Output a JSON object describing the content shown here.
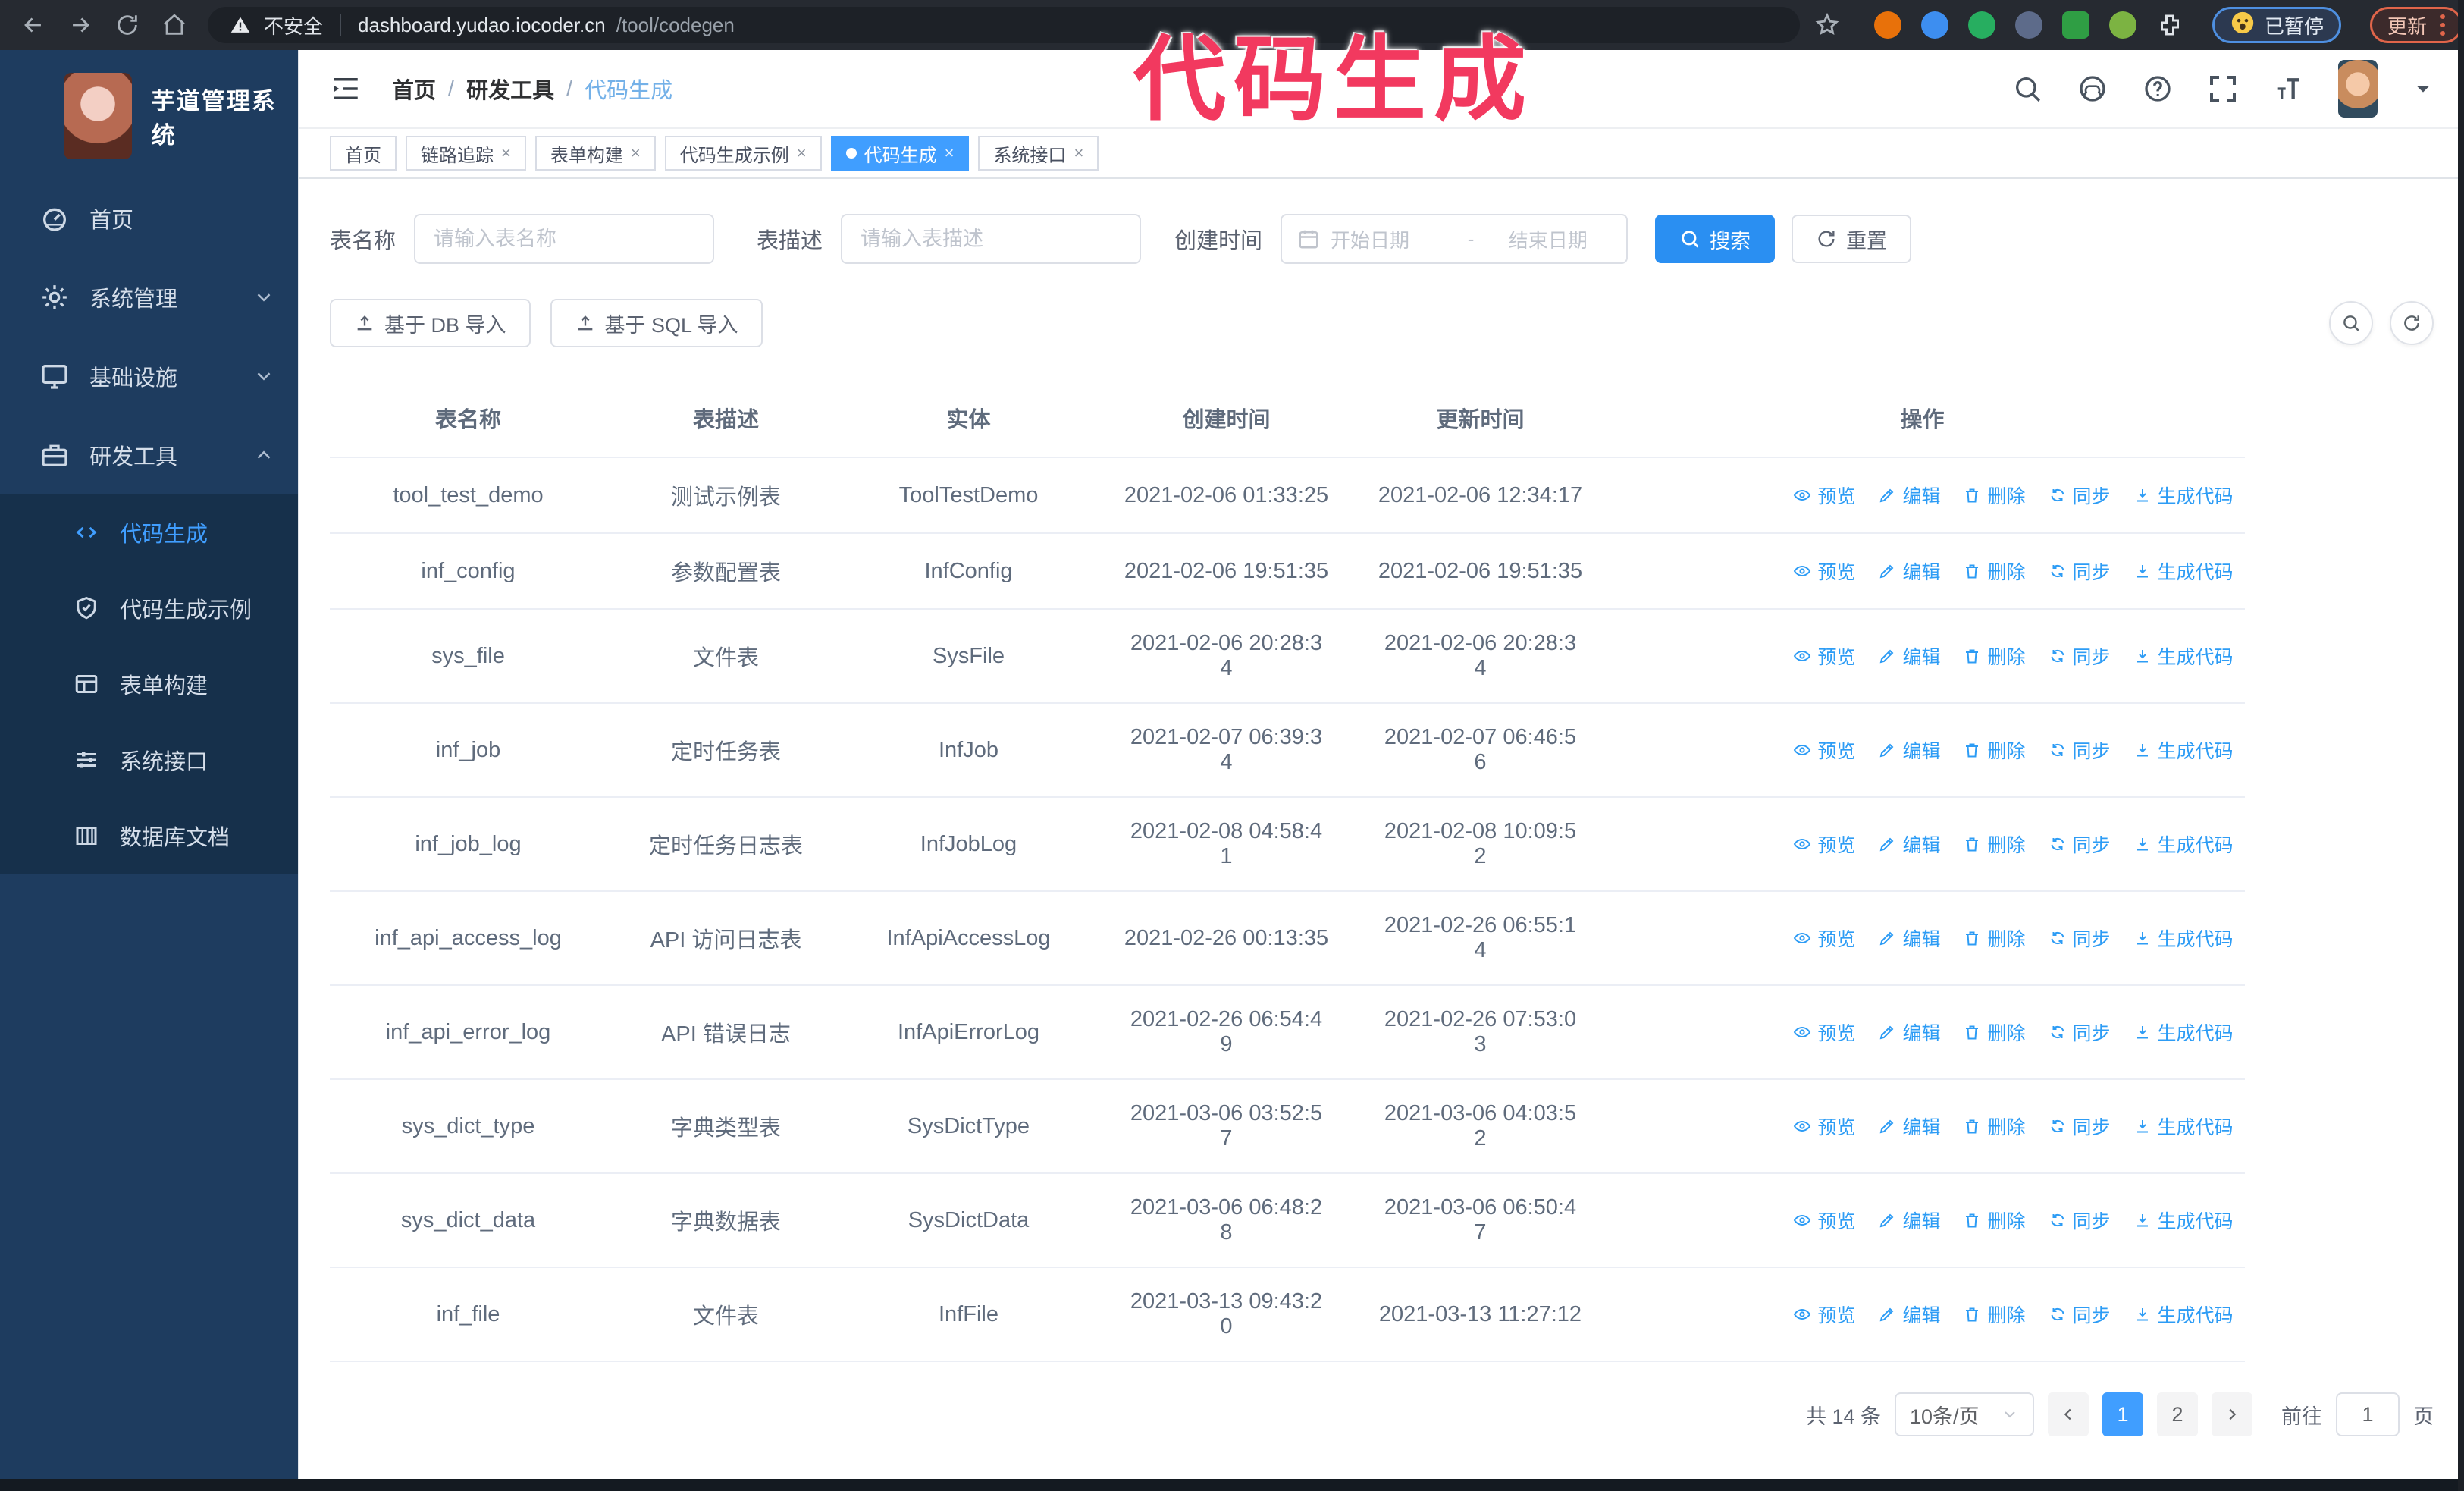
{
  "browser": {
    "security_label": "不安全",
    "url_host": "dashboard.yudao.iocoder.cn",
    "url_path": "/tool/codegen",
    "extensions": [
      {
        "name": "extension-orange",
        "color": "#e8710a"
      },
      {
        "name": "extension-blue-gem",
        "color": "#3d8ef0"
      },
      {
        "name": "extension-green-check",
        "color": "#27ae60"
      },
      {
        "name": "extension-grid",
        "color": "#5d6b8a"
      },
      {
        "name": "extension-on-badge",
        "color": "#2f9e44"
      },
      {
        "name": "extension-green-bot",
        "color": "#7cb342"
      },
      {
        "name": "extension-puzzle",
        "color": "#e8eaed"
      }
    ],
    "paused_label": "已暂停",
    "update_label": "更新"
  },
  "annotation": {
    "text": "代码生成",
    "color": "#f2395f"
  },
  "sidebar": {
    "title": "芋道管理系统",
    "items": [
      {
        "label": "首页",
        "icon": "dashboard-icon",
        "chevron": "",
        "expanded": false,
        "active": false
      },
      {
        "label": "系统管理",
        "icon": "gear-icon",
        "chevron": "down",
        "expanded": false,
        "active": false
      },
      {
        "label": "基础设施",
        "icon": "monitor-icon",
        "chevron": "down",
        "expanded": false,
        "active": false
      },
      {
        "label": "研发工具",
        "icon": "toolbox-icon",
        "chevron": "up",
        "expanded": true,
        "active": false
      }
    ],
    "submenu": [
      {
        "label": "代码生成",
        "icon": "code-icon",
        "active": true
      },
      {
        "label": "代码生成示例",
        "icon": "shield-check-icon",
        "active": false
      },
      {
        "label": "表单构建",
        "icon": "form-icon",
        "active": false
      },
      {
        "label": "系统接口",
        "icon": "sliders-icon",
        "active": false
      },
      {
        "label": "数据库文档",
        "icon": "database-icon",
        "active": false
      }
    ]
  },
  "header": {
    "breadcrumb": [
      "首页",
      "研发工具",
      "代码生成"
    ],
    "separator": "/"
  },
  "tabs": [
    {
      "label": "首页",
      "closable": false,
      "active": false
    },
    {
      "label": "链路追踪",
      "closable": true,
      "active": false
    },
    {
      "label": "表单构建",
      "closable": true,
      "active": false
    },
    {
      "label": "代码生成示例",
      "closable": true,
      "active": false
    },
    {
      "label": "代码生成",
      "closable": true,
      "active": true
    },
    {
      "label": "系统接口",
      "closable": true,
      "active": false
    }
  ],
  "filters": {
    "name_label": "表名称",
    "name_placeholder": "请输入表名称",
    "desc_label": "表描述",
    "desc_placeholder": "请输入表描述",
    "time_label": "创建时间",
    "start_placeholder": "开始日期",
    "range_separator": "-",
    "end_placeholder": "结束日期",
    "search_label": "搜索",
    "reset_label": "重置"
  },
  "toolbar": {
    "import_db_label": "基于 DB 导入",
    "import_sql_label": "基于 SQL 导入"
  },
  "table": {
    "columns": [
      "表名称",
      "表描述",
      "实体",
      "创建时间",
      "更新时间",
      "操作"
    ],
    "actions": [
      {
        "label": "预览",
        "icon": "eye-icon"
      },
      {
        "label": "编辑",
        "icon": "edit-icon"
      },
      {
        "label": "删除",
        "icon": "delete-icon"
      },
      {
        "label": "同步",
        "icon": "sync-icon"
      },
      {
        "label": "生成代码",
        "icon": "download-icon"
      }
    ],
    "rows": [
      {
        "name": "tool_test_demo",
        "desc": "测试示例表",
        "entity": "ToolTestDemo",
        "created": "2021-02-06 01:33:25",
        "updated": "2021-02-06 12:34:17"
      },
      {
        "name": "inf_config",
        "desc": "参数配置表",
        "entity": "InfConfig",
        "created": "2021-02-06 19:51:35",
        "updated": "2021-02-06 19:51:35"
      },
      {
        "name": "sys_file",
        "desc": "文件表",
        "entity": "SysFile",
        "created": "2021-02-06 20:28:3\n4",
        "updated": "2021-02-06 20:28:3\n4"
      },
      {
        "name": "inf_job",
        "desc": "定时任务表",
        "entity": "InfJob",
        "created": "2021-02-07 06:39:3\n4",
        "updated": "2021-02-07 06:46:5\n6"
      },
      {
        "name": "inf_job_log",
        "desc": "定时任务日志表",
        "entity": "InfJobLog",
        "created": "2021-02-08 04:58:4\n1",
        "updated": "2021-02-08 10:09:5\n2"
      },
      {
        "name": "inf_api_access_log",
        "desc": "API 访问日志表",
        "entity": "InfApiAccessLog",
        "created": "2021-02-26 00:13:35",
        "updated": "2021-02-26 06:55:1\n4"
      },
      {
        "name": "inf_api_error_log",
        "desc": "API 错误日志",
        "entity": "InfApiErrorLog",
        "created": "2021-02-26 06:54:4\n9",
        "updated": "2021-02-26 07:53:0\n3"
      },
      {
        "name": "sys_dict_type",
        "desc": "字典类型表",
        "entity": "SysDictType",
        "created": "2021-03-06 03:52:5\n7",
        "updated": "2021-03-06 04:03:5\n2"
      },
      {
        "name": "sys_dict_data",
        "desc": "字典数据表",
        "entity": "SysDictData",
        "created": "2021-03-06 06:48:2\n8",
        "updated": "2021-03-06 06:50:4\n7"
      },
      {
        "name": "inf_file",
        "desc": "文件表",
        "entity": "InfFile",
        "created": "2021-03-13 09:43:2\n0",
        "updated": "2021-03-13 11:27:12"
      }
    ]
  },
  "pagination": {
    "total_label": "共 14 条",
    "page_size_label": "10条/页",
    "pages": [
      "1",
      "2"
    ],
    "active_page": "1",
    "goto_label": "前往",
    "goto_value": "1",
    "unit_label": "页"
  }
}
